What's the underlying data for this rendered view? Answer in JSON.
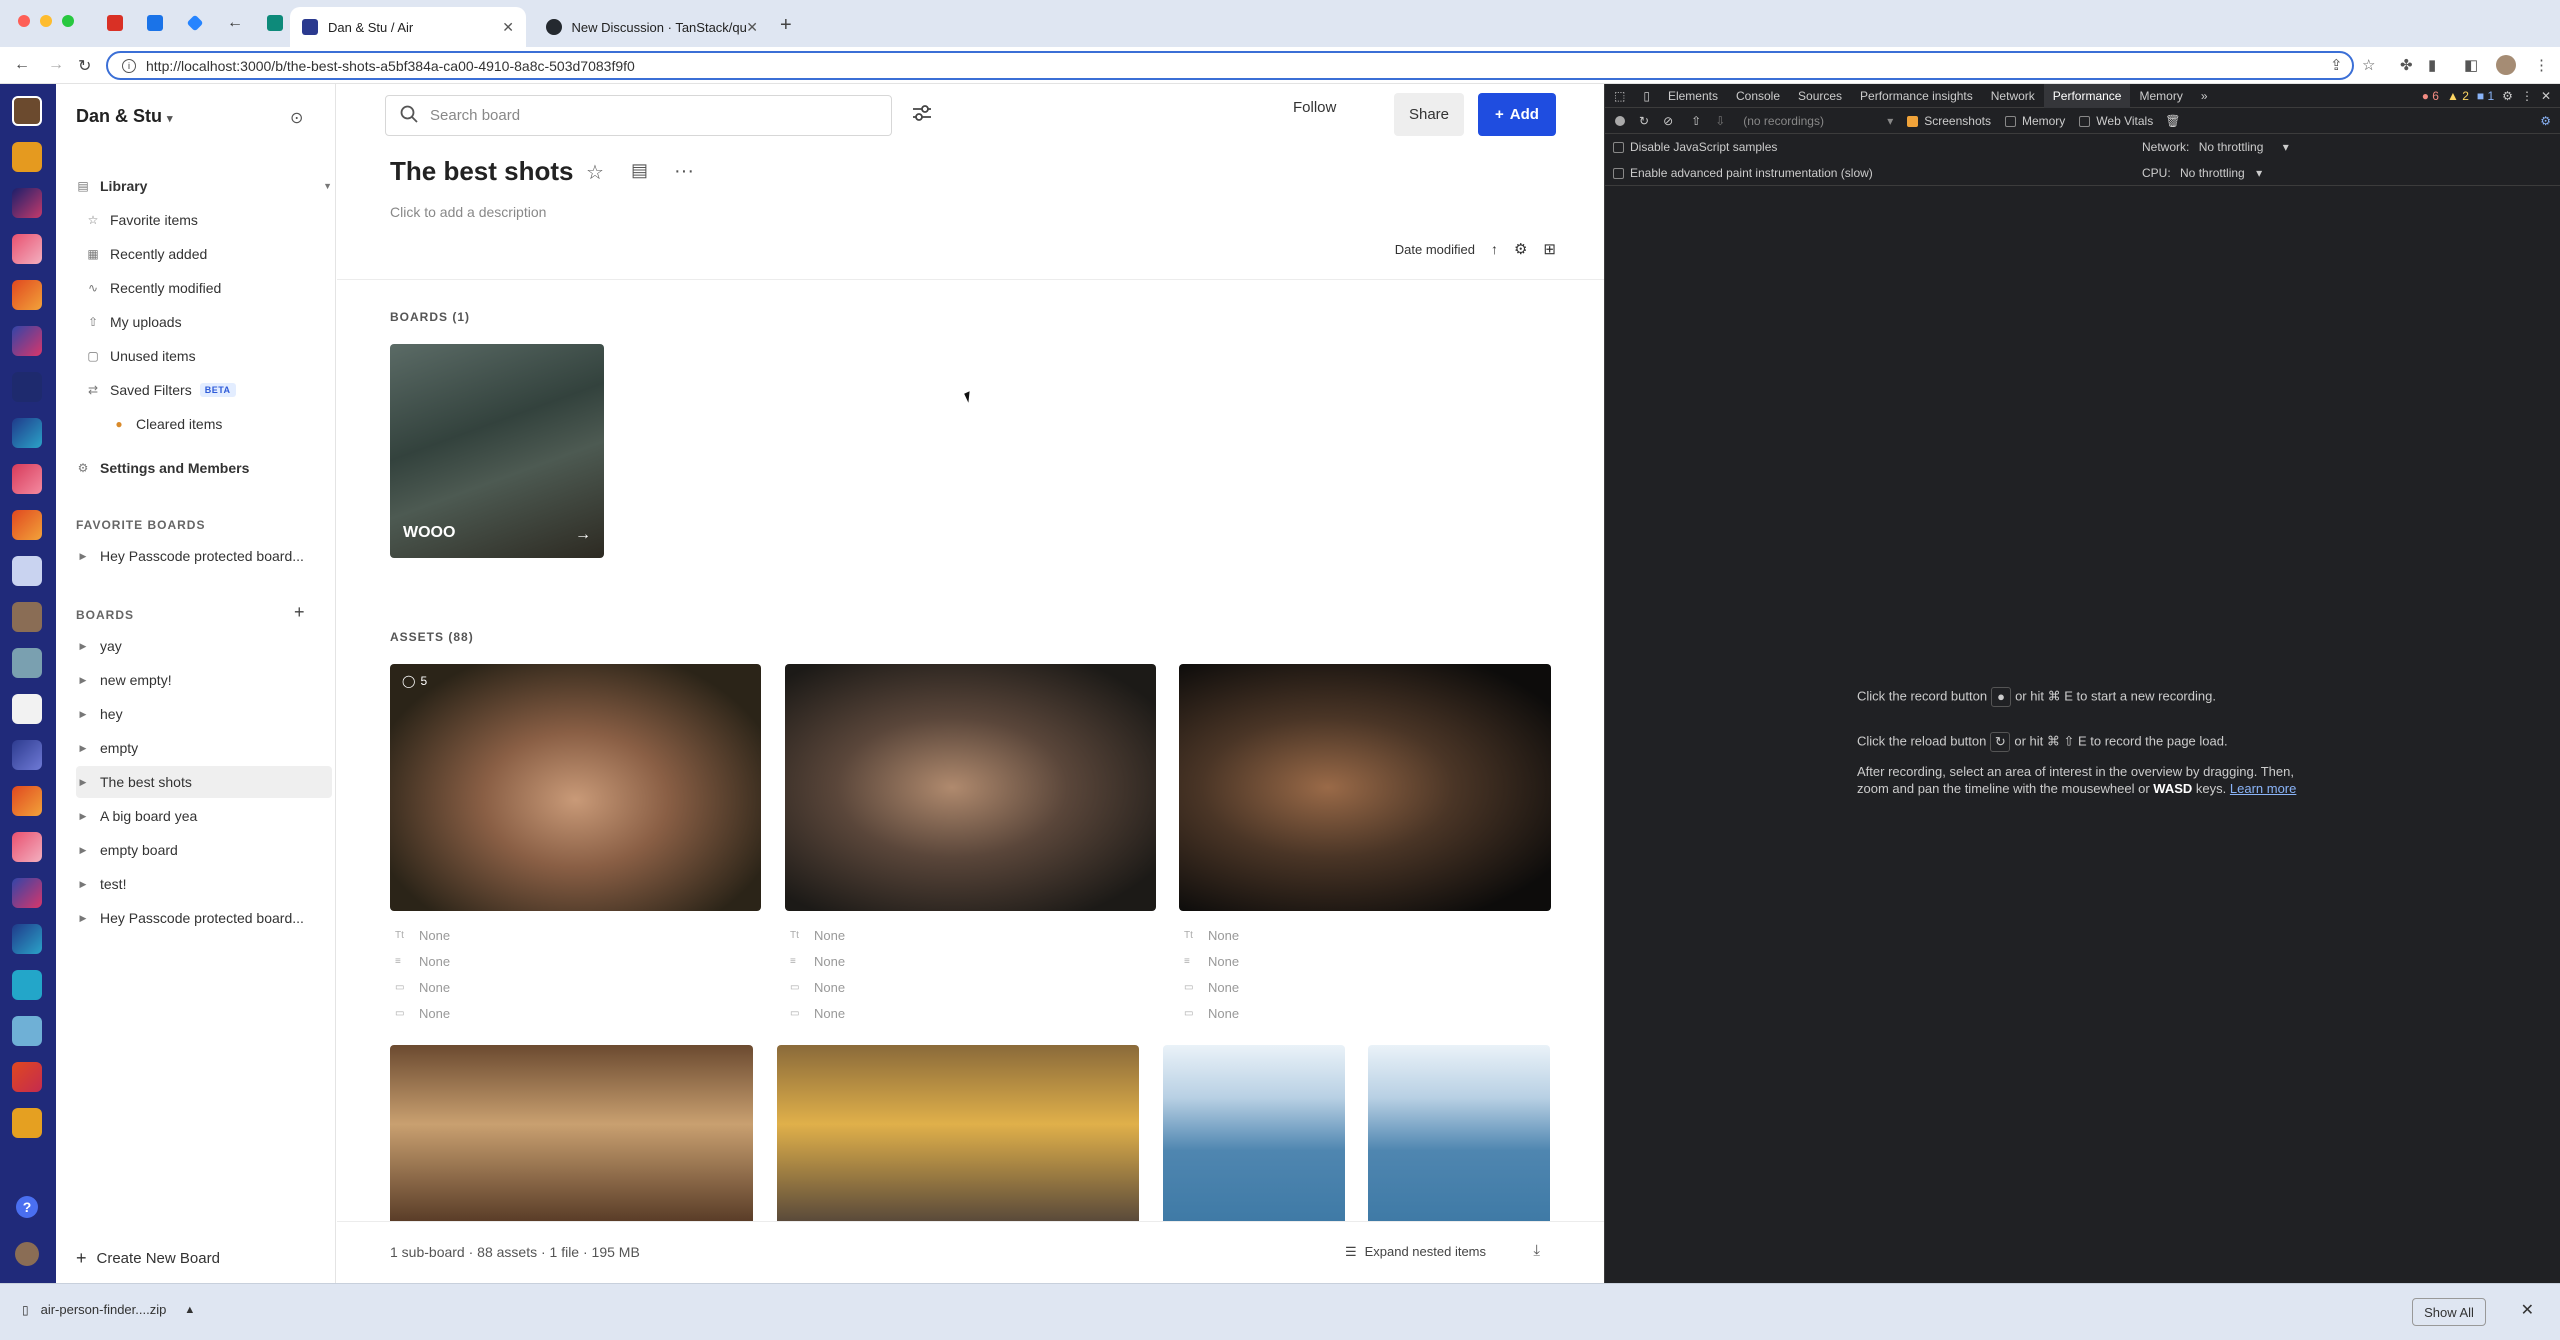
{
  "browser": {
    "tabs": [
      {
        "title": "Dan & Stu / Air",
        "active": true
      },
      {
        "title": "New Discussion · TanStack/qu",
        "active": false
      }
    ],
    "url": "http://localhost:3000/b/the-best-shots-a5bf384a-ca00-4910-8a8c-503d7083f9f0"
  },
  "sidebar": {
    "workspace_name": "Dan & Stu",
    "library_label": "Library",
    "library_items": [
      {
        "label": "Favorite items",
        "icon": "star-icon"
      },
      {
        "label": "Recently added",
        "icon": "calendar-icon"
      },
      {
        "label": "Recently modified",
        "icon": "activity-icon"
      },
      {
        "label": "My uploads",
        "icon": "upload-icon"
      },
      {
        "label": "Unused items",
        "icon": "unused-icon"
      },
      {
        "label": "Saved Filters",
        "icon": "filter-icon"
      },
      {
        "label": "Cleared items",
        "icon": "cookie-icon"
      }
    ],
    "beta_badge": "BETA",
    "settings_label": "Settings and Members",
    "favorite_boards_header": "FAVORITE BOARDS",
    "favorite_boards": [
      "Hey Passcode protected board..."
    ],
    "boards_header": "BOARDS",
    "boards": [
      "yay",
      "new empty!",
      "hey",
      "empty",
      "The best shots",
      "A big board yea",
      "empty board",
      "test!",
      "Hey Passcode protected board..."
    ],
    "selected_board": "The best shots",
    "create_board_label": "Create New Board"
  },
  "header": {
    "search_placeholder": "Search board",
    "follow_label": "Follow",
    "share_label": "Share",
    "add_label": "Add"
  },
  "board": {
    "title": "The best shots",
    "description_placeholder": "Click to add a description",
    "sort_label": "Date modified",
    "boards_section": "BOARDS (1)",
    "sub_boards": [
      {
        "name": "WOOO"
      }
    ],
    "assets_section": "ASSETS (88)",
    "first_asset_comments": "5",
    "meta_none": "None"
  },
  "footer": {
    "stats": "1 sub-board · 88 assets · 1 file · 195 MB",
    "expand_label": "Expand nested items"
  },
  "devtools": {
    "tabs": [
      "Elements",
      "Console",
      "Sources",
      "Performance insights",
      "Network",
      "Performance",
      "Memory"
    ],
    "active_tab": "Performance",
    "badges": {
      "errors": "6",
      "warnings": "2",
      "info": "1"
    },
    "recordings_placeholder": "(no recordings)",
    "screenshots_label": "Screenshots",
    "memory_label": "Memory",
    "webvitals_label": "Web Vitals",
    "disable_js_label": "Disable JavaScript samples",
    "paint_label": "Enable advanced paint instrumentation (slow)",
    "network_label": "Network:",
    "network_value": "No throttling",
    "cpu_label": "CPU:",
    "cpu_value": "No throttling",
    "msg1_a": "Click the record button",
    "msg1_b": "or hit ⌘ E to start a new recording.",
    "msg2_a": "Click the reload button",
    "msg2_b": "or hit ⌘ ⇧ E to record the page load.",
    "msg3": "After recording, select an area of interest in the overview by dragging. Then,",
    "msg4_a": "zoom and pan the timeline with the mousewheel or",
    "msg4_b": "WASD",
    "msg4_c": "keys.",
    "learn_more": "Learn more"
  },
  "downloads": {
    "file": "air-person-finder....zip",
    "show_all": "Show All"
  },
  "colors": {
    "accent": "#1f4de0",
    "app_strip": "#202a7a",
    "devtools_bg": "#202124"
  }
}
